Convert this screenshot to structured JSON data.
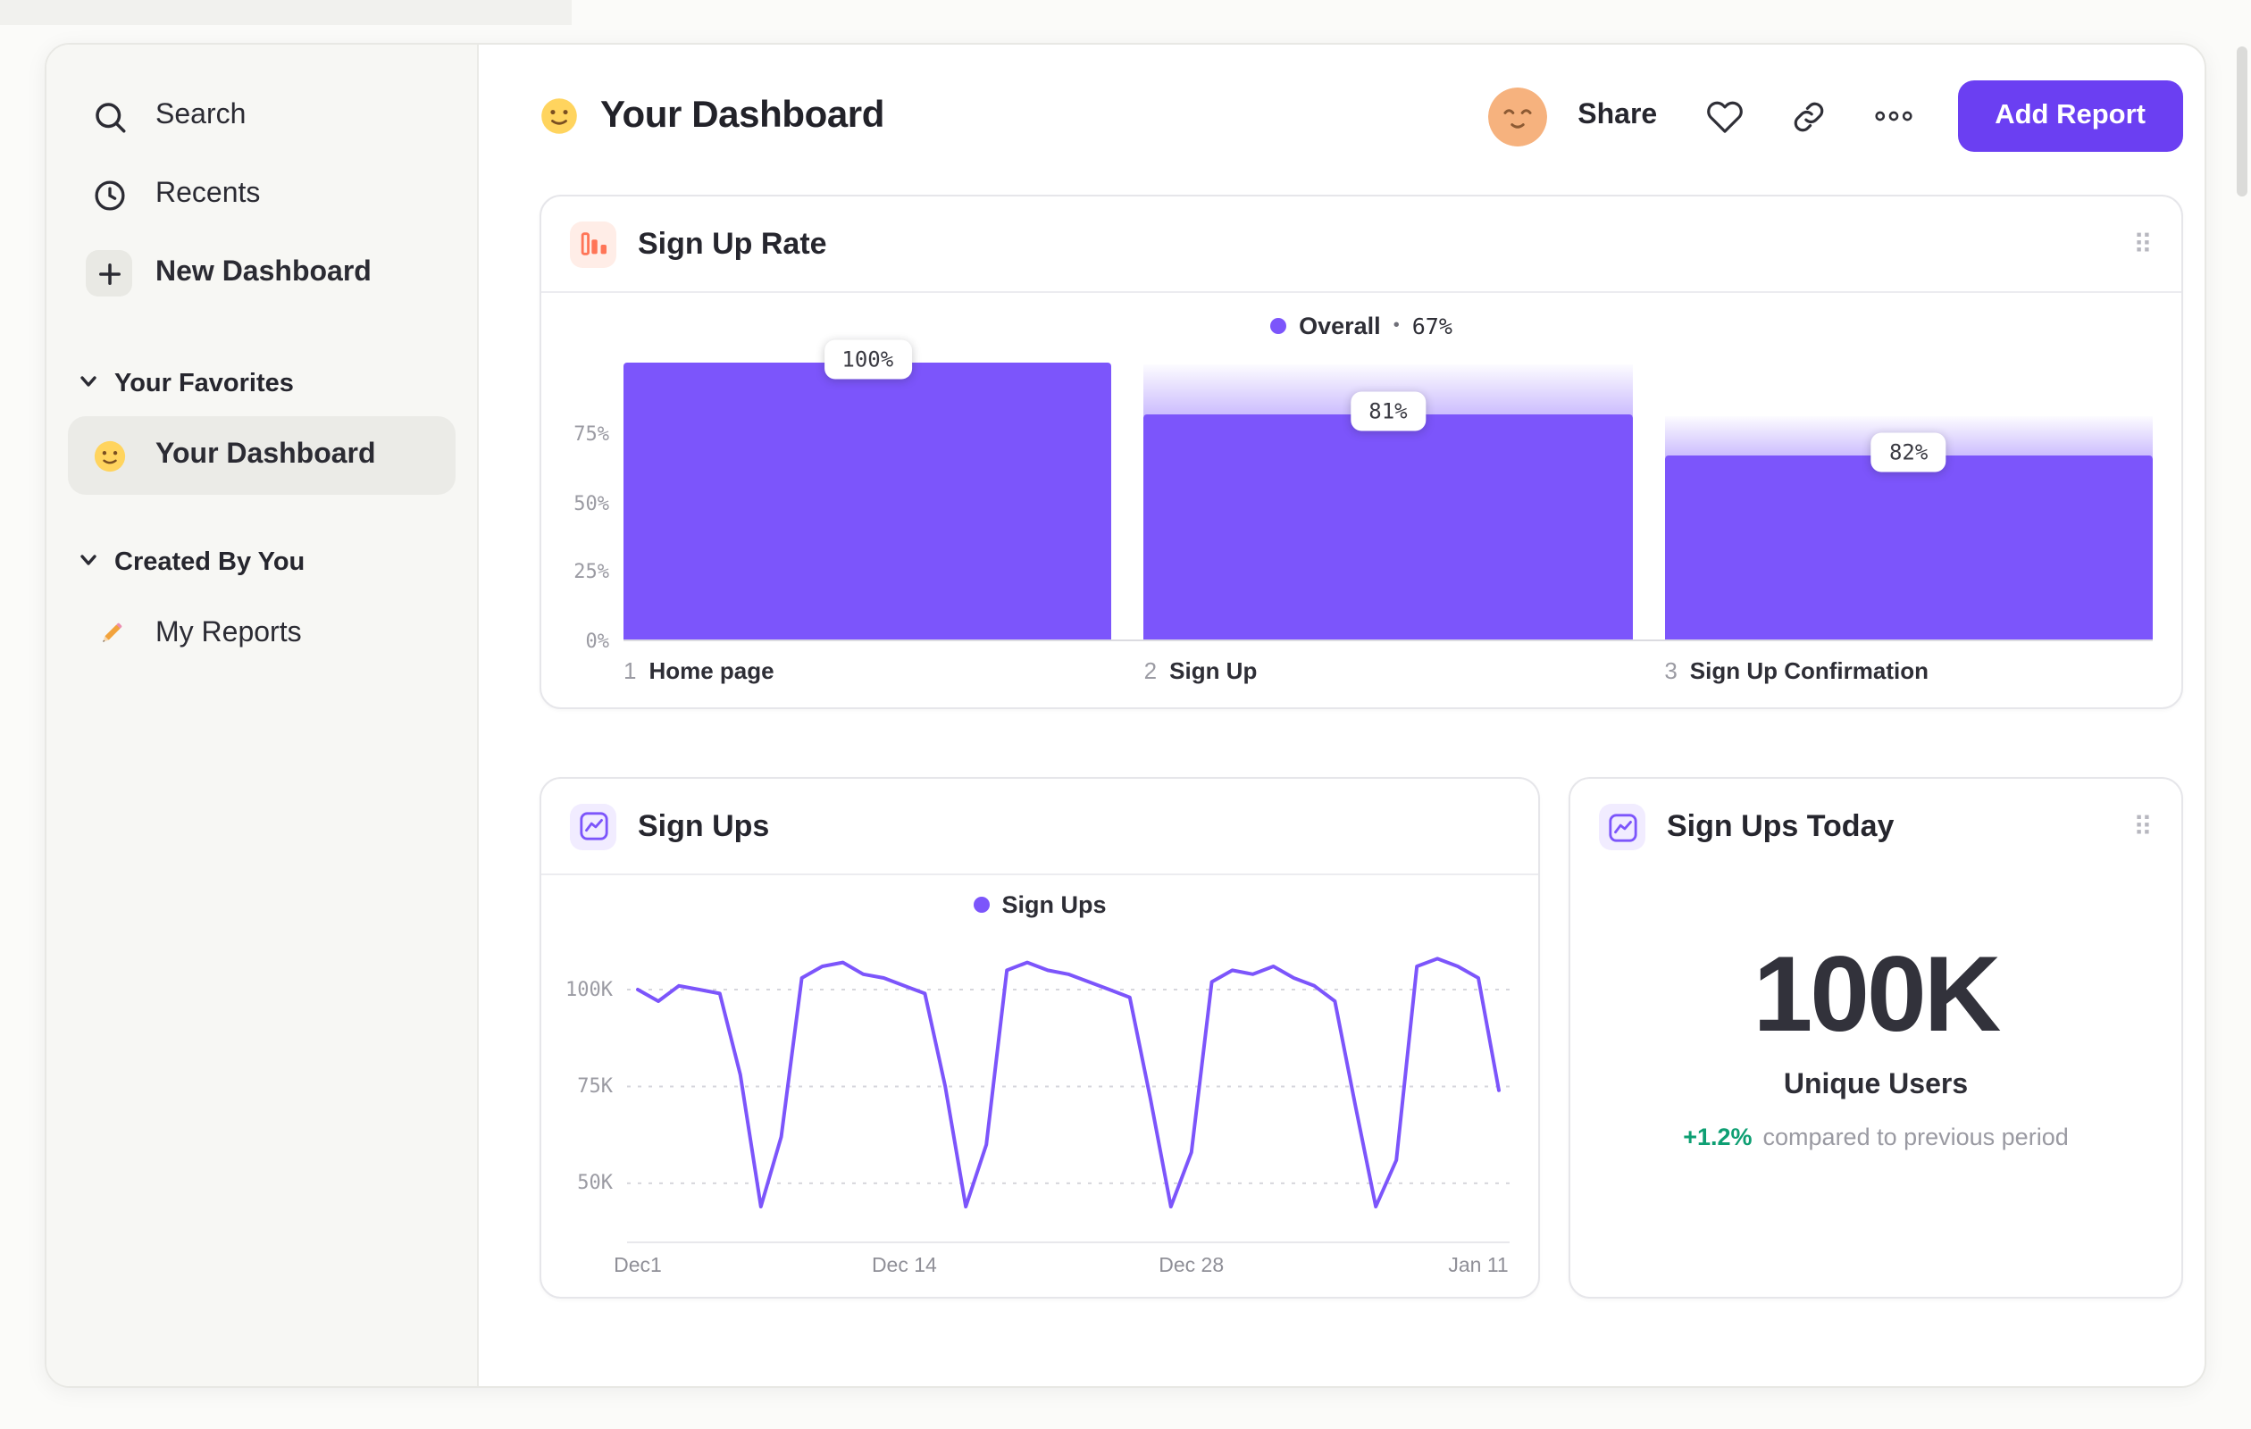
{
  "colors": {
    "accent_purple": "#7C55FB",
    "button_purple": "#6B3FF2",
    "icon_orange": "#FF7557",
    "delta_green": "#0E9F73",
    "sidebar_bg": "#F7F7F4"
  },
  "icons": {
    "search": "search-icon",
    "recents": "clock-icon",
    "new_dashboard": "plus-icon",
    "section_chevron": "chevron-down-icon",
    "favorite": "smiley-icon",
    "reports": "pencil-icon",
    "avatar": "relieved-face-avatar",
    "heart": "heart-icon",
    "link": "link-icon",
    "more": "ellipsis-icon",
    "funnel": "funnel-chart-icon",
    "line": "line-chart-icon",
    "drag": "⠿"
  },
  "sidebar": {
    "search_label": "Search",
    "recents_label": "Recents",
    "new_dashboard_label": "New Dashboard",
    "favorites_header": "Your Favorites",
    "favorite_item_label": "Your Dashboard",
    "created_header": "Created By You",
    "created_item_label": "My Reports"
  },
  "header": {
    "title": "Your Dashboard",
    "share_label": "Share",
    "add_report_label": "Add Report"
  },
  "chart_data": [
    {
      "type": "bar",
      "subtype": "funnel",
      "title": "Sign Up Rate",
      "legend_label": "Overall",
      "legend_separator": "•",
      "legend_value": "67%",
      "ylim": [
        0,
        100
      ],
      "grid": false,
      "y_ticks": [
        {
          "label": "75%",
          "value": 75
        },
        {
          "label": "50%",
          "value": 50
        },
        {
          "label": "25%",
          "value": 25
        },
        {
          "label": "0%",
          "value": 0
        }
      ],
      "steps": [
        {
          "index": "1",
          "label": "Home page",
          "conversion": 100,
          "overall": 100
        },
        {
          "index": "2",
          "label": "Sign Up",
          "conversion": 81,
          "overall": 81
        },
        {
          "index": "3",
          "label": "Sign Up Confirmation",
          "conversion": 82,
          "overall": 66.4
        }
      ]
    },
    {
      "type": "line",
      "title": "Sign Ups",
      "legend": "Sign Ups",
      "ylabel": "",
      "xlabel": "",
      "unit": "K",
      "y_domain": [
        35,
        112
      ],
      "grid": "dotted-horizontal",
      "legend_position": "top-center",
      "y_ticks": [
        {
          "label": "100K",
          "value": 100
        },
        {
          "label": "75K",
          "value": 75
        },
        {
          "label": "50K",
          "value": 50
        }
      ],
      "x_ticks": [
        {
          "label": "Dec1",
          "day": 0
        },
        {
          "label": "Dec 14",
          "day": 13
        },
        {
          "label": "Dec 28",
          "day": 27
        },
        {
          "label": "Jan 11",
          "day": 41
        }
      ],
      "points": [
        [
          0,
          100
        ],
        [
          1,
          97
        ],
        [
          2,
          101
        ],
        [
          3,
          100
        ],
        [
          4,
          99
        ],
        [
          5,
          78
        ],
        [
          6,
          44
        ],
        [
          7,
          62
        ],
        [
          8,
          103
        ],
        [
          9,
          106
        ],
        [
          10,
          107
        ],
        [
          11,
          104
        ],
        [
          12,
          103
        ],
        [
          13,
          101
        ],
        [
          14,
          99
        ],
        [
          15,
          75
        ],
        [
          16,
          44
        ],
        [
          17,
          60
        ],
        [
          18,
          105
        ],
        [
          19,
          107
        ],
        [
          20,
          105
        ],
        [
          21,
          104
        ],
        [
          22,
          102
        ],
        [
          23,
          100
        ],
        [
          24,
          98
        ],
        [
          25,
          72
        ],
        [
          26,
          44
        ],
        [
          27,
          58
        ],
        [
          28,
          102
        ],
        [
          29,
          105
        ],
        [
          30,
          104
        ],
        [
          31,
          106
        ],
        [
          32,
          103
        ],
        [
          33,
          101
        ],
        [
          34,
          97
        ],
        [
          35,
          70
        ],
        [
          36,
          44
        ],
        [
          37,
          56
        ],
        [
          38,
          106
        ],
        [
          39,
          108
        ],
        [
          40,
          106
        ],
        [
          41,
          103
        ],
        [
          42,
          74
        ]
      ]
    },
    {
      "type": "metric",
      "title": "Sign Ups Today",
      "value": "100K",
      "label": "Unique Users",
      "delta": "+1.2%",
      "delta_note": "compared to previous period"
    }
  ]
}
